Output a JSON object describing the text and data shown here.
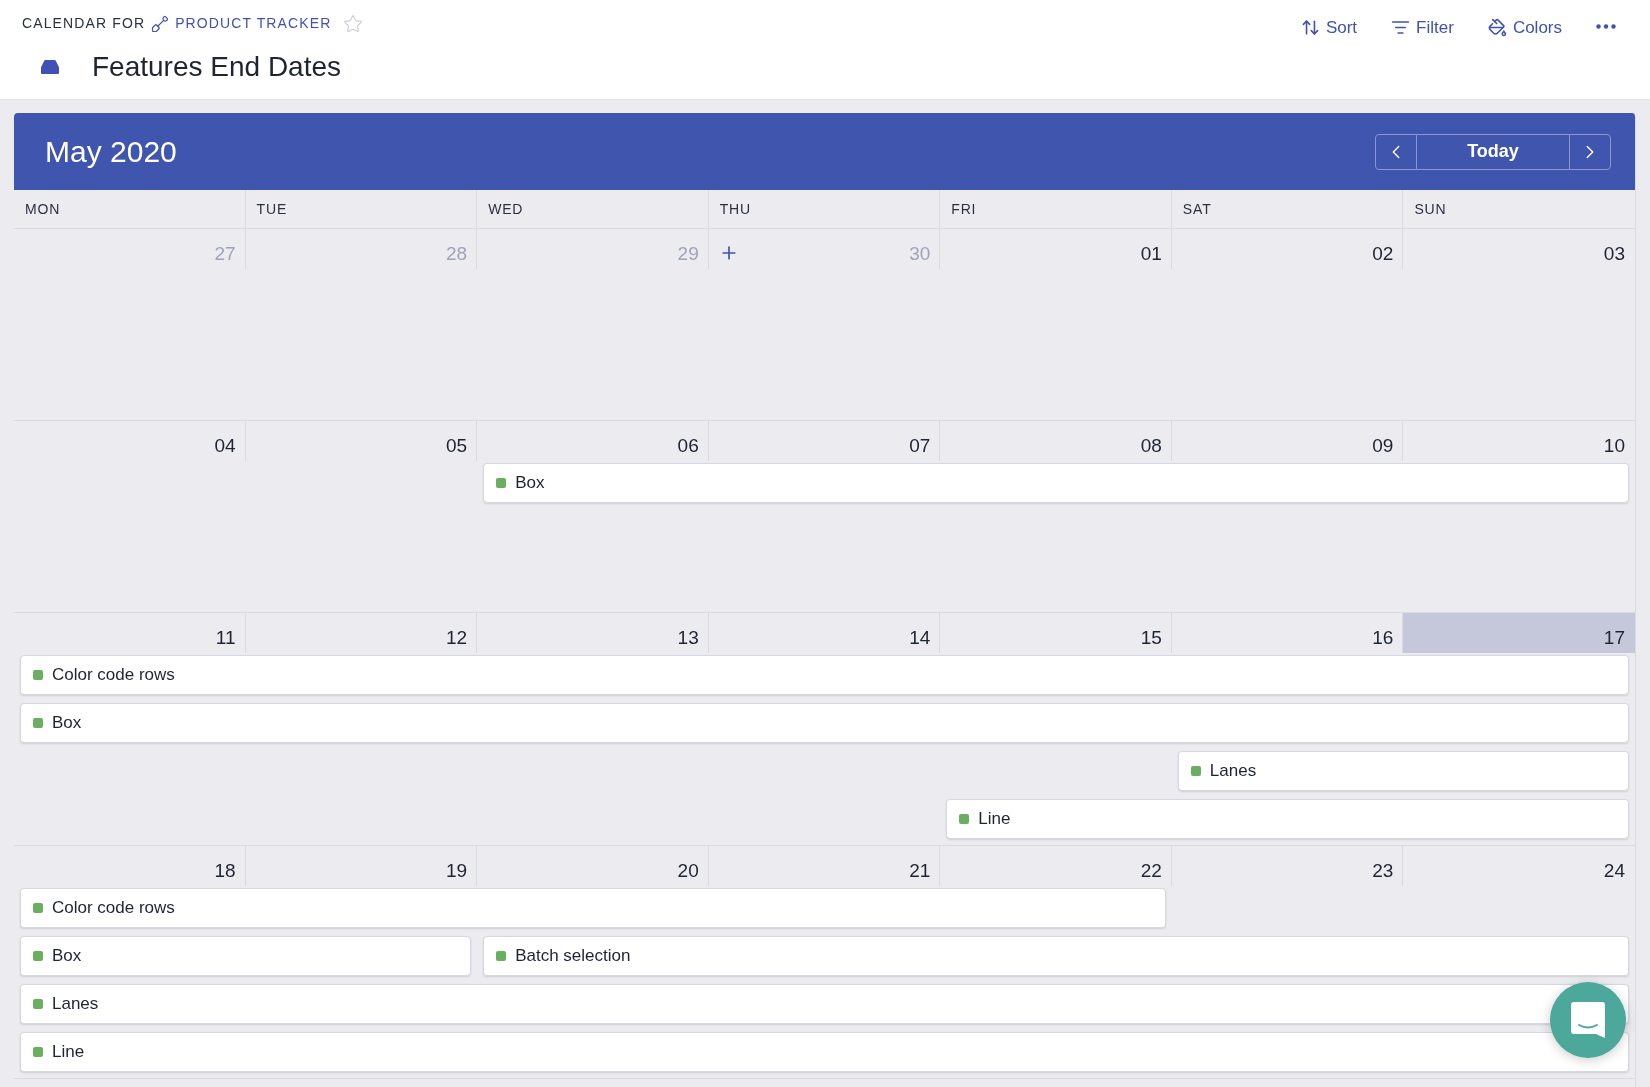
{
  "breadcrumb": {
    "prefix": "CALENDAR FOR",
    "link": "PRODUCT TRACKER",
    "starred": false
  },
  "title": "Features End Dates",
  "toolbar": [
    {
      "kind": "sort",
      "label": "Sort"
    },
    {
      "kind": "filter",
      "label": "Filter"
    },
    {
      "kind": "colors",
      "label": "Colors"
    },
    {
      "kind": "more"
    }
  ],
  "calendar": {
    "month": "May 2020",
    "today_button": "Today",
    "weekdays": [
      "MON",
      "TUE",
      "WED",
      "THU",
      "FRI",
      "SAT",
      "SUN"
    ],
    "weeks": [
      {
        "days": [
          {
            "date": "27",
            "muted": true,
            "today": false
          },
          {
            "date": "28",
            "muted": true,
            "today": false
          },
          {
            "date": "29",
            "muted": true,
            "today": false
          },
          {
            "date": "30",
            "muted": true,
            "today": false,
            "add": true
          },
          {
            "date": "01",
            "muted": false,
            "today": false
          },
          {
            "date": "02",
            "muted": false,
            "today": false
          },
          {
            "date": "03",
            "muted": false,
            "today": false
          }
        ]
      },
      {
        "days": [
          {
            "date": "04",
            "muted": false,
            "today": false
          },
          {
            "date": "05",
            "muted": false,
            "today": false
          },
          {
            "date": "06",
            "muted": false,
            "today": false
          },
          {
            "date": "07",
            "muted": false,
            "today": false
          },
          {
            "date": "08",
            "muted": false,
            "today": false
          },
          {
            "date": "09",
            "muted": false,
            "today": false
          },
          {
            "date": "10",
            "muted": false,
            "today": false
          }
        ],
        "lanes": [
          [
            {
              "kind": "empty"
            },
            {
              "kind": "empty"
            },
            {
              "kind": "event",
              "label": "Box",
              "color": "#6aaf5f"
            },
            {
              "kind": "continued"
            },
            {
              "kind": "continued"
            },
            {
              "kind": "continued"
            },
            {
              "kind": "continued"
            }
          ]
        ]
      },
      {
        "days": [
          {
            "date": "11",
            "muted": false,
            "today": false
          },
          {
            "date": "12",
            "muted": false,
            "today": false
          },
          {
            "date": "13",
            "muted": false,
            "today": false
          },
          {
            "date": "14",
            "muted": false,
            "today": false
          },
          {
            "date": "15",
            "muted": false,
            "today": false
          },
          {
            "date": "16",
            "muted": false,
            "today": false
          },
          {
            "date": "17",
            "muted": false,
            "today": true
          }
        ],
        "lanes": [
          [
            {
              "kind": "event",
              "label": "Color code rows",
              "color": "#6aaf5f"
            },
            {
              "kind": "continued"
            },
            {
              "kind": "continued"
            },
            {
              "kind": "continued"
            },
            {
              "kind": "continued"
            },
            {
              "kind": "continued"
            },
            {
              "kind": "continued"
            }
          ],
          [
            {
              "kind": "event",
              "label": "Box",
              "color": "#6aaf5f"
            },
            {
              "kind": "continued"
            },
            {
              "kind": "continued"
            },
            {
              "kind": "continued"
            },
            {
              "kind": "continued"
            },
            {
              "kind": "continued"
            },
            {
              "kind": "continued"
            }
          ],
          [
            {
              "kind": "empty"
            },
            {
              "kind": "empty"
            },
            {
              "kind": "empty"
            },
            {
              "kind": "empty"
            },
            {
              "kind": "empty"
            },
            {
              "kind": "event",
              "label": "Lanes",
              "color": "#6aaf5f"
            },
            {
              "kind": "continued"
            }
          ],
          [
            {
              "kind": "empty"
            },
            {
              "kind": "empty"
            },
            {
              "kind": "empty"
            },
            {
              "kind": "empty"
            },
            {
              "kind": "event",
              "label": "Line",
              "color": "#6aaf5f"
            },
            {
              "kind": "continued"
            },
            {
              "kind": "continued"
            }
          ]
        ]
      },
      {
        "days": [
          {
            "date": "18",
            "muted": false,
            "today": false
          },
          {
            "date": "19",
            "muted": false,
            "today": false
          },
          {
            "date": "20",
            "muted": false,
            "today": false
          },
          {
            "date": "21",
            "muted": false,
            "today": false
          },
          {
            "date": "22",
            "muted": false,
            "today": false
          },
          {
            "date": "23",
            "muted": false,
            "today": false
          },
          {
            "date": "24",
            "muted": false,
            "today": false
          }
        ],
        "lanes": [
          [
            {
              "kind": "event",
              "label": "Color code rows",
              "color": "#6aaf5f"
            },
            {
              "kind": "continued"
            },
            {
              "kind": "continued"
            },
            {
              "kind": "continued"
            },
            {
              "kind": "continued"
            },
            {
              "kind": "empty"
            },
            {
              "kind": "empty"
            }
          ],
          [
            {
              "kind": "event",
              "label": "Box",
              "color": "#6aaf5f"
            },
            {
              "kind": "continued"
            },
            {
              "kind": "event",
              "label": "Batch selection",
              "color": "#6aaf5f"
            },
            {
              "kind": "continued"
            },
            {
              "kind": "continued"
            },
            {
              "kind": "continued"
            },
            {
              "kind": "continued"
            }
          ],
          [
            {
              "kind": "event",
              "label": "Lanes",
              "color": "#6aaf5f"
            },
            {
              "kind": "continued"
            },
            {
              "kind": "continued"
            },
            {
              "kind": "continued"
            },
            {
              "kind": "continued"
            },
            {
              "kind": "continued"
            },
            {
              "kind": "continued"
            }
          ],
          [
            {
              "kind": "event",
              "label": "Line",
              "color": "#6aaf5f"
            },
            {
              "kind": "continued"
            },
            {
              "kind": "continued"
            },
            {
              "kind": "continued"
            },
            {
              "kind": "continued"
            },
            {
              "kind": "continued"
            },
            {
              "kind": "continued"
            }
          ]
        ]
      }
    ]
  }
}
